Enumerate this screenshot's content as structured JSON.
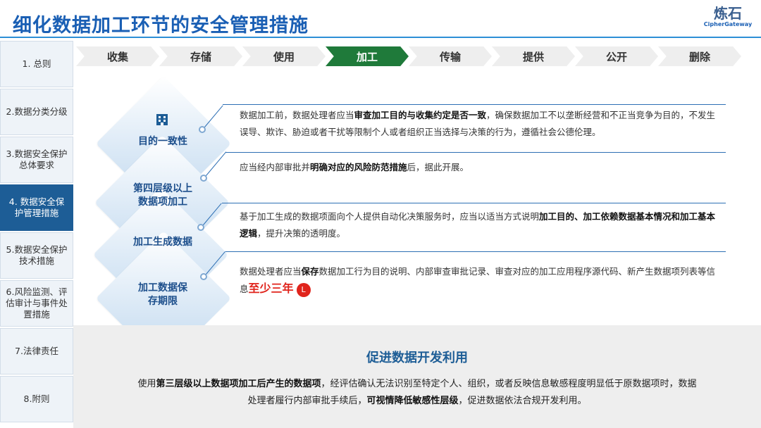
{
  "header": {
    "title": "细化数据加工环节的安全管理措施",
    "logo_cn": "炼石",
    "logo_en": "CipherGateway"
  },
  "nav": {
    "items": [
      "1. 总则",
      "2.数据分类分级",
      "3.数据安全保护总体要求",
      "4. 数据安全保护管理措施",
      "5.数据安全保护技术措施",
      "6.风险监测、评估审计与事件处置措施",
      "7.法律责任",
      "8.附则"
    ],
    "active_index": 3
  },
  "steps": {
    "items": [
      "收集",
      "存储",
      "使用",
      "加工",
      "传输",
      "提供",
      "公开",
      "删除"
    ],
    "active_index": 3
  },
  "sections": [
    {
      "label": "目的一致性",
      "icon": "building-icon",
      "text": [
        {
          "t": "数据加工前，数据处理者应当"
        },
        {
          "t": "审查加工目的与收集约定是否一致",
          "b": true
        },
        {
          "t": "，确保数据加工不以垄断经营和不正当竞争为目的，不发生误导、欺诈、胁迫或者干扰等限制个人或者组织正当选择与决策的行为，遵循社会公德伦理。"
        }
      ]
    },
    {
      "label": "第四层级以上数据项加工",
      "text": [
        {
          "t": "应当经内部审批并"
        },
        {
          "t": "明确对应的风险防范措施",
          "b": true
        },
        {
          "t": "后，据此开展。"
        }
      ]
    },
    {
      "label": "加工生成数据",
      "text": [
        {
          "t": "基于加工生成的数据项面向个人提供自动化决策服务时，应当以适当方式说明"
        },
        {
          "t": "加工目的、加工依赖数据基本情况和加工基本逻辑",
          "b": true
        },
        {
          "t": "，提升决策的透明度。"
        }
      ]
    },
    {
      "label": "加工数据保存期限",
      "highlight": "至少三年",
      "highlight_icon": "clock-icon",
      "text": [
        {
          "t": "数据处理者应当"
        },
        {
          "t": "保存",
          "b": true
        },
        {
          "t": "数据加工行为目的说明、内部审查审批记录、审查对应的加工应用程序源代码、新产生数据项列表等信息"
        }
      ]
    }
  ],
  "bottom": {
    "title": "促进数据开发利用",
    "text": [
      {
        "t": "使用"
      },
      {
        "t": "第三层级以上数据项加工后产生的数据项",
        "b": true
      },
      {
        "t": "，经评估确认无法识别至特定个人、组织，或者反映信息敏感程度明显低于原数据项时，数据处理者履行内部审批手续后，"
      },
      {
        "t": "可视情降低敏感性层级",
        "b": true
      },
      {
        "t": "，促进数据依法合规开发利用。"
      }
    ]
  },
  "colors": {
    "accent": "#1a5fb4",
    "active_nav": "#1d5d96",
    "active_step": "#1f7a3a",
    "highlight": "#e0241c"
  }
}
